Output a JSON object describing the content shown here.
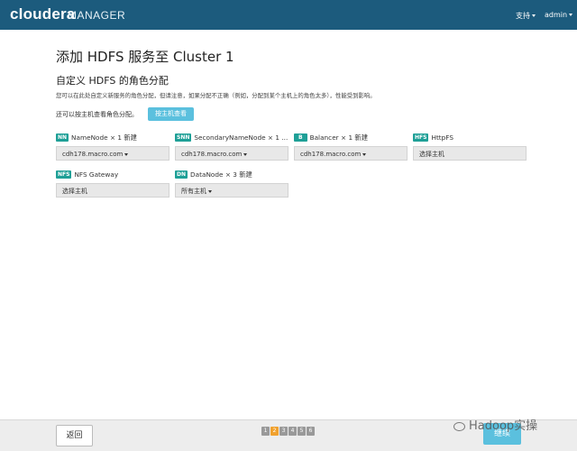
{
  "header": {
    "brand": "cloudera",
    "brand_sub": "MANAGER",
    "support_label": "支持",
    "admin_label": "admin"
  },
  "main": {
    "page_title": "添加 HDFS 服务至 Cluster 1",
    "section_title": "自定义 HDFS 的角色分配",
    "description": "您可以在此处自定义新服务的角色分配，但请注意，如果分配不正确（例如，分配到某个主机上的角色太多），性能受到影响。",
    "host_hint": "还可以按主机查看角色分配。",
    "host_view_button": "按主机查看"
  },
  "roles": [
    {
      "badge": "NN",
      "name": "NameNode",
      "count": "× 1 新建",
      "value": "cdh178.macro.com"
    },
    {
      "badge": "SNN",
      "name": "SecondaryNameNode",
      "count": "× 1 ...",
      "value": "cdh178.macro.com"
    },
    {
      "badge": "B",
      "name": "Balancer",
      "count": "× 1 新建",
      "value": "cdh178.macro.com"
    },
    {
      "badge": "HFS",
      "name": "HttpFS",
      "count": "",
      "value": "选择主机"
    },
    {
      "badge": "NFS",
      "name": "NFS Gateway",
      "count": "",
      "value": "选择主机"
    },
    {
      "badge": "DN",
      "name": "DataNode",
      "count": "× 3 新建",
      "value": "所有主机"
    }
  ],
  "footer": {
    "back_label": "返回",
    "pages": [
      "1",
      "2",
      "3",
      "4",
      "5",
      "6"
    ],
    "active_page": "2",
    "continue_label": "继续"
  },
  "watermark": "Hadoop实操",
  "colors": {
    "topbar": "#1c5b7d",
    "badge": "#1fa097",
    "primary_button": "#5bc0de",
    "active_page": "#f0a12e"
  }
}
